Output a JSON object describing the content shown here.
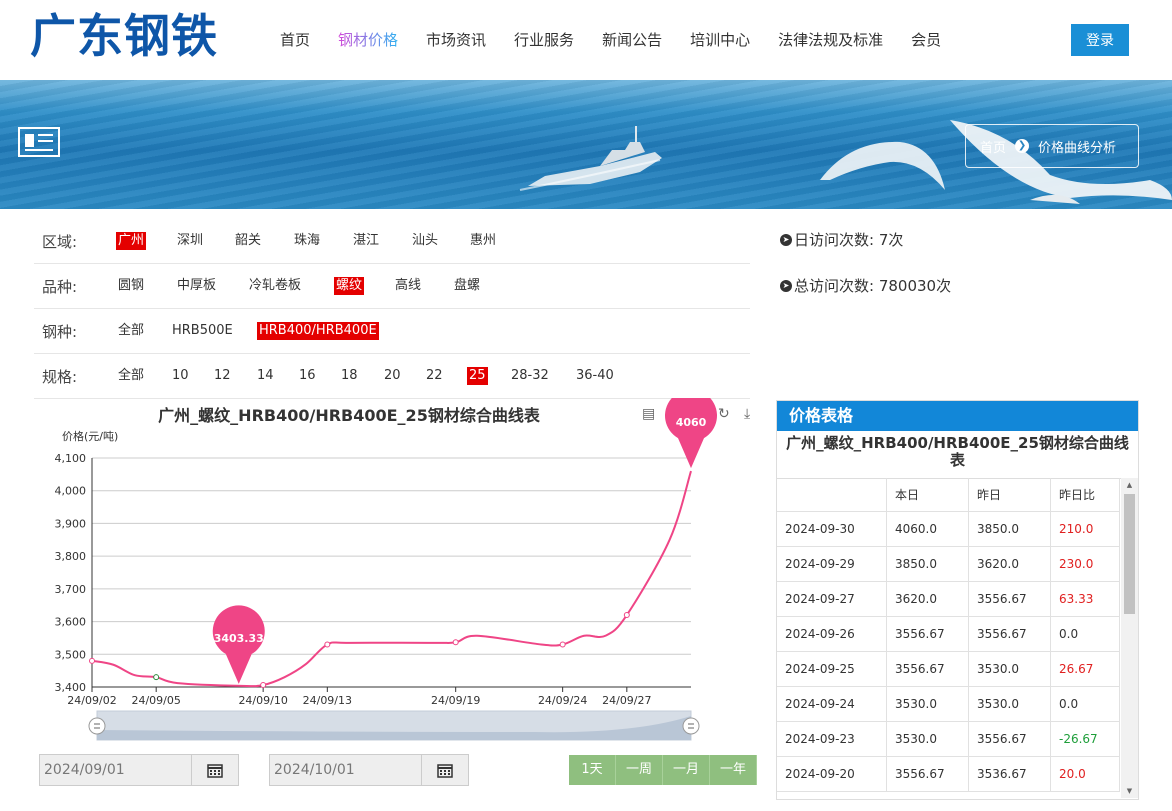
{
  "header": {
    "logo": "广东钢铁",
    "nav": [
      "首页",
      "钢材价格",
      "市场资讯",
      "行业服务",
      "新闻公告",
      "培训中心",
      "法律法规及标准",
      "会员"
    ],
    "active_nav": "钢材价格",
    "login_label": "登录"
  },
  "banner": {
    "crumb_home": "首页",
    "crumb_current": "价格曲线分析"
  },
  "filters": {
    "region": {
      "label": "区域:",
      "options": [
        "广州",
        "深圳",
        "韶关",
        "珠海",
        "湛江",
        "汕头",
        "惠州"
      ],
      "selected": "广州"
    },
    "variety": {
      "label": "品种:",
      "options": [
        "圆钢",
        "中厚板",
        "冷轧卷板",
        "螺纹",
        "高线",
        "盘螺"
      ],
      "selected": "螺纹"
    },
    "grade": {
      "label": "钢种:",
      "options": [
        "全部",
        "HRB500E",
        "HRB400/HRB400E"
      ],
      "selected": "HRB400/HRB400E"
    },
    "spec": {
      "label": "规格:",
      "options": [
        "全部",
        "10",
        "12",
        "14",
        "16",
        "18",
        "20",
        "22",
        "25",
        "28-32",
        "36-40"
      ],
      "selected": "25"
    }
  },
  "stats": {
    "daily": "日访问次数: 7次",
    "total": "总访问次数: 780030次"
  },
  "chart_data": {
    "type": "line",
    "title": "广州_螺纹_HRB400/HRB400E_25钢材综合曲线表",
    "ylabel": "价格(元/吨)",
    "ylim": [
      3400,
      4100
    ],
    "yticks": [
      "3,400",
      "3,500",
      "3,600",
      "3,700",
      "3,800",
      "3,900",
      "4,000",
      "4,100"
    ],
    "xticks": [
      "24/09/02",
      "24/09/05",
      "24/09/10",
      "24/09/13",
      "24/09/19",
      "24/09/24",
      "24/09/27"
    ],
    "x": [
      "2024-09-02",
      "2024-09-03",
      "2024-09-04",
      "2024-09-05",
      "2024-09-06",
      "2024-09-09",
      "2024-09-10",
      "2024-09-11",
      "2024-09-12",
      "2024-09-13",
      "2024-09-14",
      "2024-09-18",
      "2024-09-19",
      "2024-09-20",
      "2024-09-23",
      "2024-09-24",
      "2024-09-25",
      "2024-09-26",
      "2024-09-27",
      "2024-09-29",
      "2024-09-30"
    ],
    "values": [
      3480,
      3468,
      3436,
      3430,
      3412,
      3403.33,
      3406,
      3430,
      3470,
      3530,
      3535,
      3535,
      3536.67,
      3556.67,
      3530,
      3530,
      3556.67,
      3556.67,
      3620,
      3850,
      4060
    ],
    "max_label": "4060",
    "min_label": "3403.33",
    "line_color": "#ef4586",
    "grid": true
  },
  "date_range": {
    "start": "2024/09/01",
    "end": "2024/10/01",
    "buttons": [
      "1天",
      "一周",
      "一月",
      "一年"
    ]
  },
  "price_table": {
    "heading": "价格表格",
    "title": "广州_螺纹_HRB400/HRB400E_25钢材综合曲线表",
    "columns": [
      "",
      "本日",
      "昨日",
      "昨日比"
    ],
    "rows": [
      [
        "2024-09-30",
        "4060.0",
        "3850.0",
        "210.0"
      ],
      [
        "2024-09-29",
        "3850.0",
        "3620.0",
        "230.0"
      ],
      [
        "2024-09-27",
        "3620.0",
        "3556.67",
        "63.33"
      ],
      [
        "2024-09-26",
        "3556.67",
        "3556.67",
        "0.0"
      ],
      [
        "2024-09-25",
        "3556.67",
        "3530.0",
        "26.67"
      ],
      [
        "2024-09-24",
        "3530.0",
        "3530.0",
        "0.0"
      ],
      [
        "2024-09-23",
        "3530.0",
        "3556.67",
        "-26.67"
      ],
      [
        "2024-09-20",
        "3556.67",
        "3536.67",
        "20.0"
      ]
    ]
  }
}
